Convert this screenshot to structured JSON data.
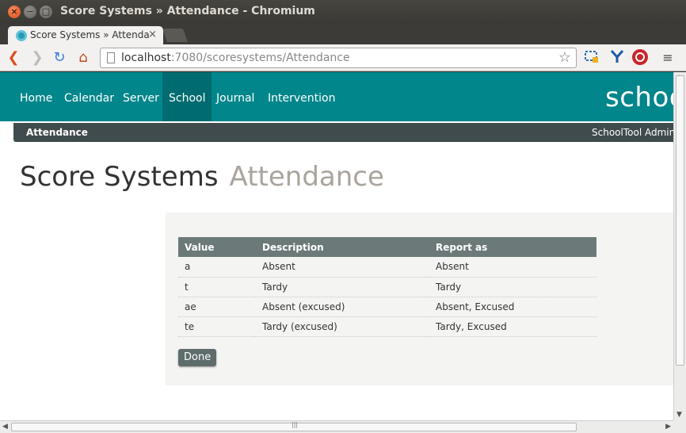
{
  "window": {
    "title": "Score Systems » Attendance - Chromium",
    "close_glyph": "×",
    "minimize_glyph": "−",
    "maximize_glyph": "□"
  },
  "tab": {
    "title": "Score Systems » Attendance",
    "close_glyph": "×"
  },
  "toolbar": {
    "back_glyph": "❮",
    "forward_glyph": "❯",
    "reload_glyph": "↻",
    "home_glyph": "⌂",
    "url_host": "localhost",
    "url_rest": ":7080/scoresystems/Attendance",
    "star_glyph": "☆",
    "menu_glyph": "≡"
  },
  "nav": {
    "items": [
      "Home",
      "Calendar",
      "Server",
      "School",
      "Journal",
      "Intervention"
    ],
    "active": "School",
    "brand": "schoo"
  },
  "subnav": {
    "left": "Attendance",
    "right": "SchoolTool Adminis"
  },
  "heading": {
    "main": "Score Systems",
    "sub": "Attendance"
  },
  "table": {
    "headers": [
      "Value",
      "Description",
      "Report as"
    ],
    "rows": [
      [
        "a",
        "Absent",
        "Absent"
      ],
      [
        "t",
        "Tardy",
        "Tardy"
      ],
      [
        "ae",
        "Absent (excused)",
        "Absent, Excused"
      ],
      [
        "te",
        "Tardy (excused)",
        "Tardy, Excused"
      ]
    ]
  },
  "done_button": "Done",
  "colors": {
    "navbar": "#00868b",
    "navbar_active": "#006b70",
    "subbar": "#3f4b4c",
    "table_header": "#6c7979",
    "button": "#5e6c6c"
  }
}
